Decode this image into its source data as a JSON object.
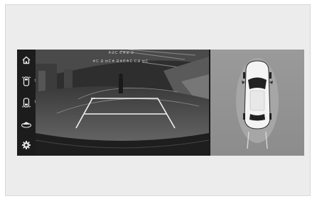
{
  "sidebar": {
    "items": [
      {
        "name": "home",
        "icon": "home-icon"
      },
      {
        "name": "front-view",
        "icon": "car-front-view-icon",
        "has_submenu": true
      },
      {
        "name": "rear-view",
        "icon": "car-rear-view-icon",
        "has_submenu": true
      },
      {
        "name": "surround-view",
        "icon": "surround-view-icon"
      },
      {
        "name": "settings",
        "icon": "gear-icon"
      }
    ]
  },
  "rear_camera": {
    "overlay_text": [
      "ㅎㄹㄷ ㅌㅎㄹ ㄹ",
      "ㅎㄷ ㄹ ㅂㄷㅎ ㄹㅊㅌㅎㄷ ㄷㄹ ㅂㄷ"
    ],
    "guide_line_color": "#f2f2f2"
  },
  "top_view": {
    "vehicle_color": "#f4f4f4",
    "ground_color": "#939393"
  },
  "colors": {
    "background": "#ececec",
    "screen": "#1a1a1a",
    "icon": "#e6e6e6"
  }
}
